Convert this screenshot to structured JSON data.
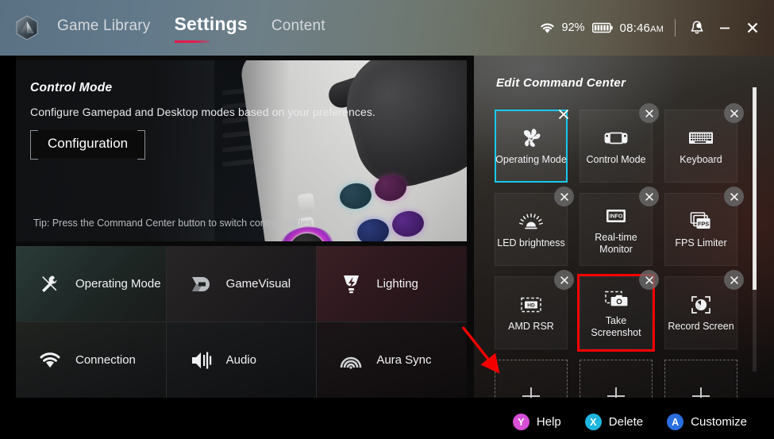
{
  "app": {
    "logo_icon": "armoury-hex-logo"
  },
  "header": {
    "tabs": [
      {
        "label": "Game Library",
        "active": false
      },
      {
        "label": "Settings",
        "active": true
      },
      {
        "label": "Content",
        "active": false
      }
    ],
    "status": {
      "wifi_icon": "wifi-icon",
      "battery_percent": "92%",
      "battery_icon": "battery-icon",
      "time": "08:46",
      "time_ampm": "AM",
      "notification_icon": "bell-icon",
      "minimize_label": "minimize-icon",
      "close_label": "close-icon"
    }
  },
  "hero": {
    "title": "Control Mode",
    "subtitle": "Configure Gamepad and Desktop modes based on your preferences.",
    "button_label": "Configuration",
    "tip": "Tip: Press the Command Center button to switch control modes"
  },
  "settings_grid": {
    "items": [
      {
        "label": "Operating Mode",
        "icon": "tools-icon"
      },
      {
        "label": "GameVisual",
        "icon": "gamevisual-icon"
      },
      {
        "label": "Lighting",
        "icon": "lighting-bolt-icon"
      },
      {
        "label": "Connection",
        "icon": "wifi-icon"
      },
      {
        "label": "Audio",
        "icon": "speaker-icon"
      },
      {
        "label": "Aura Sync",
        "icon": "aura-sync-icon"
      }
    ]
  },
  "command_center": {
    "title": "Edit Command Center",
    "selected_border_color": "#18c8f0",
    "annotation_color": "#f50000",
    "remove_icon": "close-icon",
    "add_icon": "plus-icon",
    "tiles": [
      {
        "label": "Operating Mode",
        "icon": "fan-icon",
        "selected": true,
        "annotated": false,
        "type": "item"
      },
      {
        "label": "Control Mode",
        "icon": "handheld-icon",
        "selected": false,
        "annotated": false,
        "type": "item"
      },
      {
        "label": "Keyboard",
        "icon": "keyboard-icon",
        "selected": false,
        "annotated": false,
        "type": "item"
      },
      {
        "label": "LED brightness",
        "icon": "brightness-icon",
        "selected": false,
        "annotated": false,
        "type": "item"
      },
      {
        "label": "Real-time Monitor",
        "icon": "monitor-info-icon",
        "selected": false,
        "annotated": false,
        "type": "item"
      },
      {
        "label": "FPS Limiter",
        "icon": "fps-stack-icon",
        "selected": false,
        "annotated": false,
        "type": "item"
      },
      {
        "label": "AMD RSR",
        "icon": "hd-icon",
        "selected": false,
        "annotated": false,
        "type": "item"
      },
      {
        "label": "Take Screenshot",
        "icon": "camera-icon",
        "selected": false,
        "annotated": true,
        "type": "item"
      },
      {
        "label": "Record Screen",
        "icon": "record-icon",
        "selected": false,
        "annotated": false,
        "type": "item"
      },
      {
        "label": "",
        "icon": "plus-icon",
        "selected": false,
        "annotated": false,
        "type": "add"
      },
      {
        "label": "",
        "icon": "plus-icon",
        "selected": false,
        "annotated": false,
        "type": "add"
      },
      {
        "label": "",
        "icon": "plus-icon",
        "selected": false,
        "annotated": false,
        "type": "add"
      }
    ]
  },
  "footer": {
    "hints": [
      {
        "key": "Y",
        "label": "Help",
        "color": "#d64fd6"
      },
      {
        "key": "X",
        "label": "Delete",
        "color": "#1fb6e0"
      },
      {
        "key": "A",
        "label": "Customize",
        "color": "#2a6fe0"
      }
    ]
  }
}
